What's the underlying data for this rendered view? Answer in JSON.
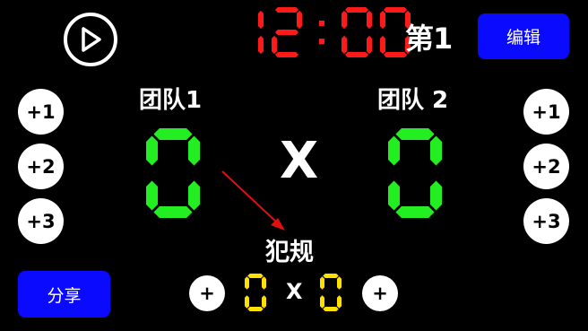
{
  "clock": {
    "time": "12:00",
    "color": "#ff1a1a"
  },
  "period": {
    "label": "第1"
  },
  "header": {
    "edit_label": "编辑"
  },
  "footer": {
    "share_label": "分享"
  },
  "teams": [
    {
      "name": "团队1",
      "score": "0",
      "buttons": [
        "+1",
        "+2",
        "+3"
      ]
    },
    {
      "name": "团队 2",
      "score": "0",
      "buttons": [
        "+1",
        "+2",
        "+3"
      ]
    }
  ],
  "versus": "X",
  "fouls": {
    "label": "犯规",
    "team1": "0",
    "team2": "0",
    "versus": "X",
    "add_label": "+"
  },
  "colors": {
    "score": "#22ee22",
    "foul": "#ffe100",
    "button": "#0a0aff"
  },
  "icons": {
    "play": "play-icon",
    "annotation": "red-arrow"
  }
}
